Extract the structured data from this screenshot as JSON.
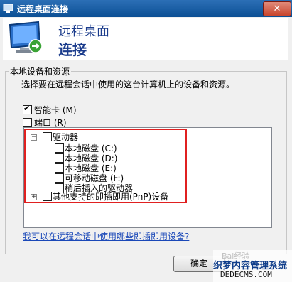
{
  "window": {
    "title": "远程桌面连接",
    "close_label": "✕"
  },
  "banner": {
    "line1": "远程桌面",
    "line2": "连接"
  },
  "group": {
    "legend": "本地设备和资源",
    "description": "选择要在远程会话中使用的这台计算机上的设备和资源。"
  },
  "options": {
    "smartcard_label": "智能卡",
    "smartcard_key": "(M)",
    "smartcard_checked": true,
    "port_label": "端口",
    "port_key": "(R)",
    "port_checked": false
  },
  "tree": {
    "drives": {
      "label": "驱动器",
      "expander": "−"
    },
    "drive_items": [
      {
        "label": "本地磁盘 (C:)"
      },
      {
        "label": "本地磁盘 (D:)"
      },
      {
        "label": "本地磁盘 (E:)"
      },
      {
        "label": "可移动磁盘 (F:)"
      },
      {
        "label": "稍后插入的驱动器"
      }
    ],
    "pnp": {
      "label": "其他支持的即插即用(PnP)设备",
      "expander": "+"
    }
  },
  "link_text": "我可以在远程会话中使用哪些即插即用设备?",
  "ok_button": "确定",
  "watermark": {
    "logo": "Bai经验",
    "line1": "织梦内容管理系统",
    "line2": "DEDECMS.COM"
  },
  "colors": {
    "title_bar": "#0b4f94",
    "banner_text": "#1b3c8c",
    "highlight_box": "#e02020",
    "link": "#1a48b8"
  }
}
